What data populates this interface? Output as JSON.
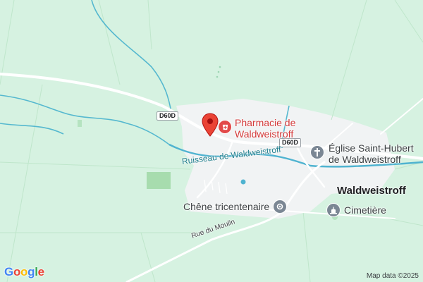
{
  "map": {
    "road_shield": "D60D",
    "waterway": "Ruisseau de Waldweistroff",
    "street": "Rue du Moulin",
    "town": "Waldweistroff",
    "pois": {
      "pharmacy": {
        "line1": "Pharmacie de",
        "line2": "Waldweistroff",
        "icon": "pharmacy-icon",
        "color": "#d43a3a"
      },
      "church": {
        "line1": "Église Saint-Hubert",
        "line2": "de Waldweistroff",
        "icon": "church-icon"
      },
      "oak": {
        "label": "Chêne tricentenaire",
        "icon": "landmark-icon"
      },
      "cemetery": {
        "label": "Cimetière",
        "icon": "cemetery-icon"
      }
    }
  },
  "branding": {
    "logo": "Google",
    "attribution": "Map data ©2025"
  },
  "colors": {
    "land": "#d6f2e1",
    "built_area": "#f1f3f4",
    "water": "#4fb3d0",
    "road": "#ffffff",
    "pin": "#ea4335"
  }
}
